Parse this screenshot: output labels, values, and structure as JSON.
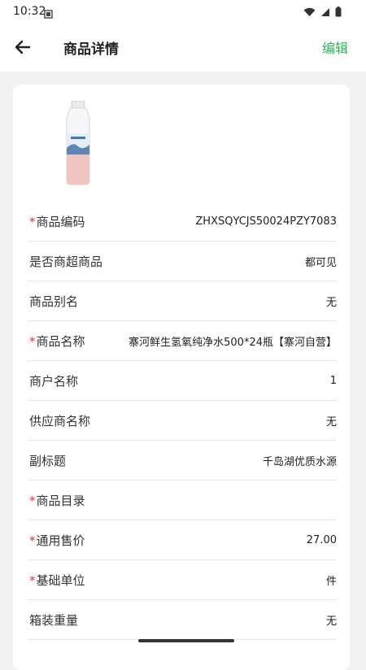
{
  "status_bar": {
    "time": "10:32"
  },
  "app_bar": {
    "title": "商品详情",
    "edit_label": "编辑"
  },
  "rows": [
    {
      "label": "商品编码",
      "required": true,
      "value": "ZHXSQYCJS50024PZY7083"
    },
    {
      "label": "是否商超商品",
      "required": false,
      "value": "都可见"
    },
    {
      "label": "商品别名",
      "required": false,
      "value": "无"
    },
    {
      "label": "商品名称",
      "required": true,
      "value": "寨河鲜生氢氧纯净水500*24瓶【寨河自营】"
    },
    {
      "label": "商户名称",
      "required": false,
      "value": "1"
    },
    {
      "label": "供应商名称",
      "required": false,
      "value": "无"
    },
    {
      "label": "副标题",
      "required": false,
      "value": "千岛湖优质水源"
    },
    {
      "label": "商品目录",
      "required": true,
      "value": ""
    },
    {
      "label": "通用售价",
      "required": true,
      "value": "27.00"
    },
    {
      "label": "基础单位",
      "required": true,
      "value": "件"
    },
    {
      "label": "箱装重量",
      "required": false,
      "value": "无"
    }
  ],
  "colors": {
    "accent": "#2fb45a",
    "required_mark": "#d83a3a",
    "background": "#f2f2f2"
  }
}
